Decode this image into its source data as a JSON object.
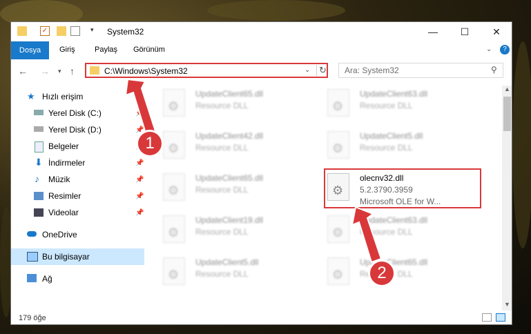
{
  "window": {
    "title": "System32",
    "controls": {
      "minimize": "—",
      "maximize": "☐",
      "close": "✕"
    }
  },
  "ribbon": {
    "tabs": [
      "Dosya",
      "Giriş",
      "Paylaş",
      "Görünüm"
    ]
  },
  "address": {
    "path": "C:\\Windows\\System32",
    "search_placeholder": "Ara: System32"
  },
  "sidebar": {
    "items": [
      {
        "label": "Hızlı erişim",
        "icon": "star-icon"
      },
      {
        "label": "Yerel Disk (C:)",
        "icon": "drive-icon"
      },
      {
        "label": "Yerel Disk (D:)",
        "icon": "drive-icon"
      },
      {
        "label": "Belgeler",
        "icon": "documents-icon"
      },
      {
        "label": "İndirmeler",
        "icon": "download-icon"
      },
      {
        "label": "Müzik",
        "icon": "music-icon"
      },
      {
        "label": "Resimler",
        "icon": "pictures-icon"
      },
      {
        "label": "Videolar",
        "icon": "videos-icon"
      },
      {
        "label": "OneDrive",
        "icon": "cloud-icon"
      },
      {
        "label": "Bu bilgisayar",
        "icon": "computer-icon"
      },
      {
        "label": "Ağ",
        "icon": "network-icon"
      }
    ]
  },
  "files": [
    {
      "name": "UpdateClient65.dll",
      "sub": "Resource DLL"
    },
    {
      "name": "UpdateClient63.dll",
      "sub": "Resource DLL"
    },
    {
      "name": "UpdateClient42.dll",
      "sub": "Resource DLL"
    },
    {
      "name": "UpdateClient5.dll",
      "sub": "Resource DLL"
    },
    {
      "name": "UpdateClient65.dll",
      "sub": "Resource DLL"
    },
    {
      "name": "olecnv32.dll",
      "sub": "5.2.3790.3959",
      "desc": "Microsoft OLE for W..."
    },
    {
      "name": "UpdateClient19.dll",
      "sub": "Resource DLL"
    },
    {
      "name": "UpdateClient63.dll",
      "sub": "Resource DLL"
    },
    {
      "name": "UpdateClient5.dll",
      "sub": "Resource DLL"
    },
    {
      "name": "UpdateClient65.dll",
      "sub": "Resource DLL"
    }
  ],
  "status": {
    "count": "179 öğe"
  },
  "annotations": {
    "step1": "1",
    "step2": "2"
  },
  "colors": {
    "accent": "#1979ca",
    "highlight": "#d9383a"
  }
}
